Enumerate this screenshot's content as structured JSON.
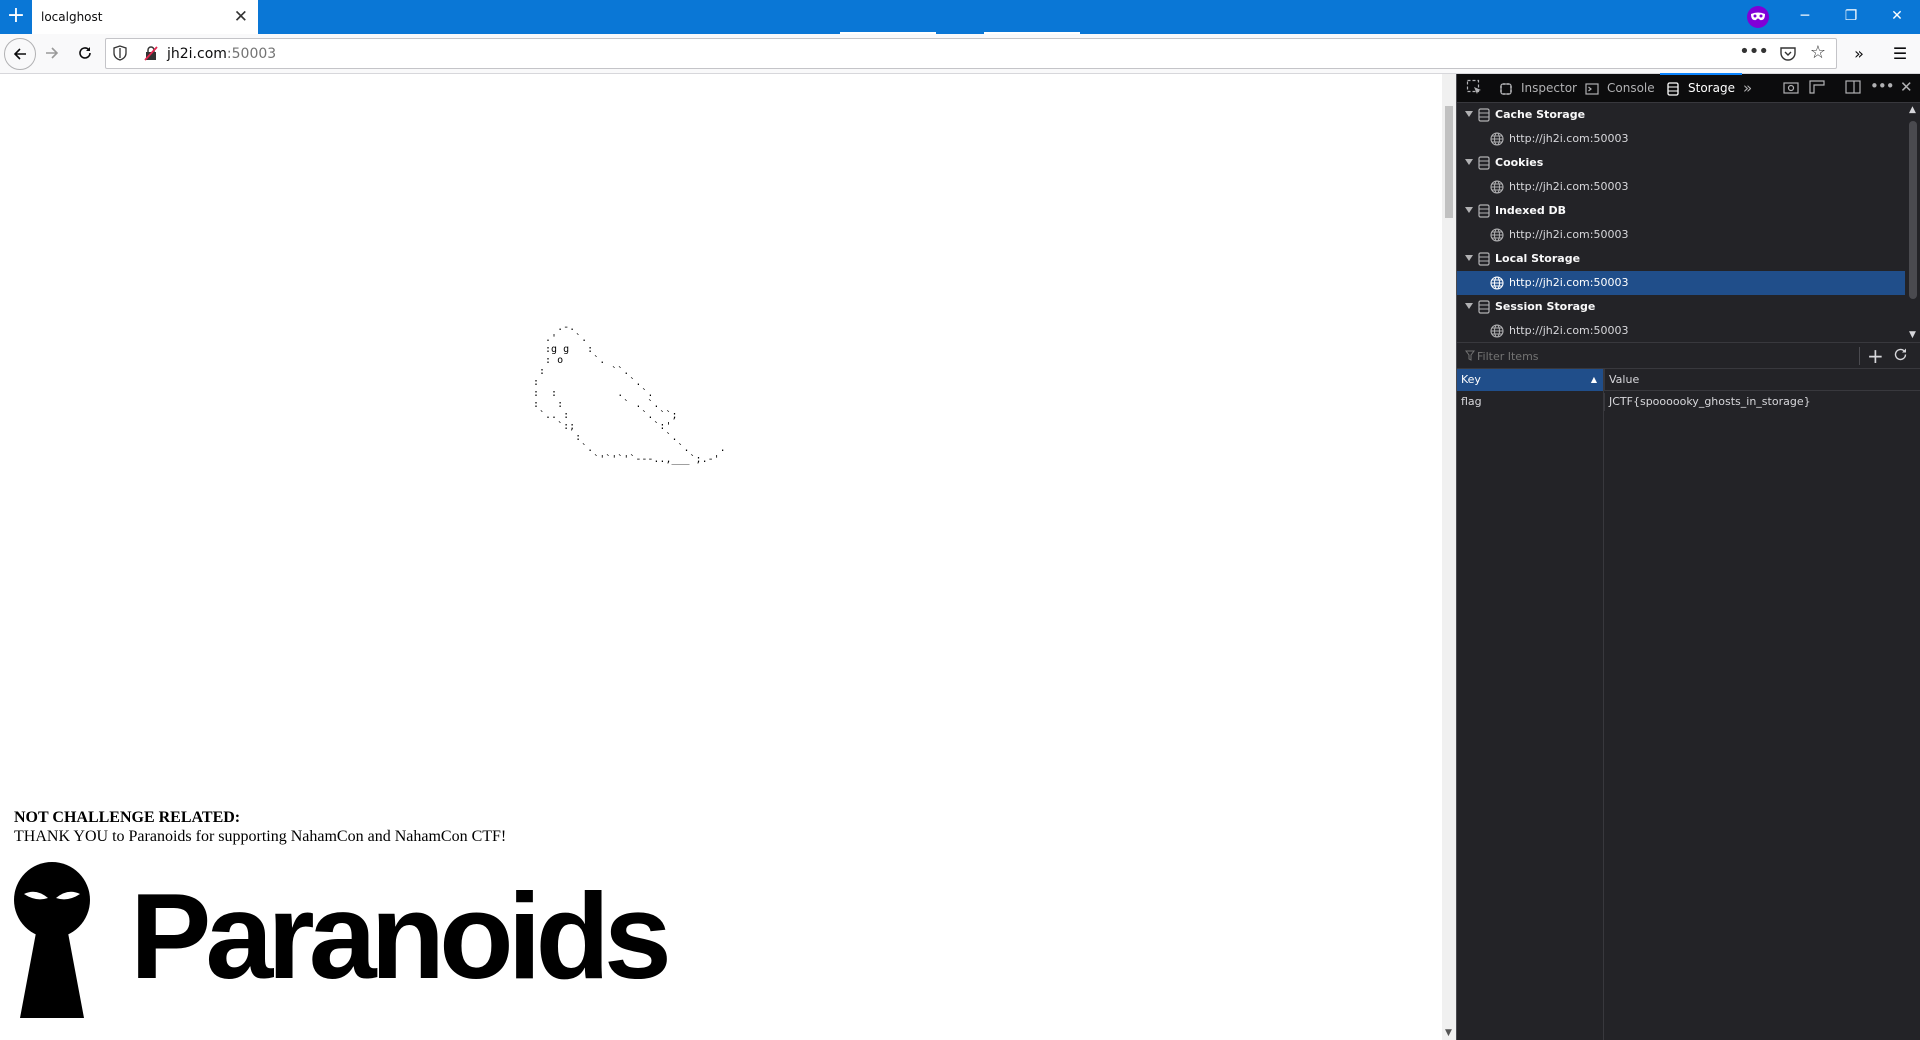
{
  "browser": {
    "tab_title": "localghost",
    "url_host": "jh2i.com",
    "url_port": ":50003"
  },
  "page": {
    "ghost_ascii": "    .-.\n  .'   `.\n  :g g   :\n  : o     `.\n :           ``.\n:               `.\n:  :          .   `.\n:   :          ` . `.\n `.. :            `. ``;\n    `:;             `:'\n       :              `.\n        `.              `.     .\n          `'`'`'`---..,___`;.-'",
    "sponsor_heading": "NOT CHALLENGE RELATED:",
    "sponsor_text": "THANK YOU to Paranoids for supporting NahamCon and NahamCon CTF!",
    "logo_text": "Paranoids"
  },
  "devtools": {
    "tabs": [
      {
        "label": "Inspector"
      },
      {
        "label": "Console"
      },
      {
        "label": "Storage"
      }
    ],
    "tree": [
      {
        "category": "Cache Storage",
        "host": "http://jh2i.com:50003"
      },
      {
        "category": "Cookies",
        "host": "http://jh2i.com:50003"
      },
      {
        "category": "Indexed DB",
        "host": "http://jh2i.com:50003"
      },
      {
        "category": "Local Storage",
        "host": "http://jh2i.com:50003"
      },
      {
        "category": "Session Storage",
        "host": "http://jh2i.com:50003"
      }
    ],
    "filter_placeholder": "Filter Items",
    "table": {
      "headers": {
        "key": "Key",
        "value": "Value"
      },
      "rows": [
        {
          "key": "flag",
          "value": "JCTF{spoooooky_ghosts_in_storage}"
        }
      ]
    }
  },
  "colors": {
    "tabbar": "#0a77d6",
    "devtools_bg": "#232327",
    "selection": "#204e8a",
    "private_mask": "#8000d7"
  }
}
